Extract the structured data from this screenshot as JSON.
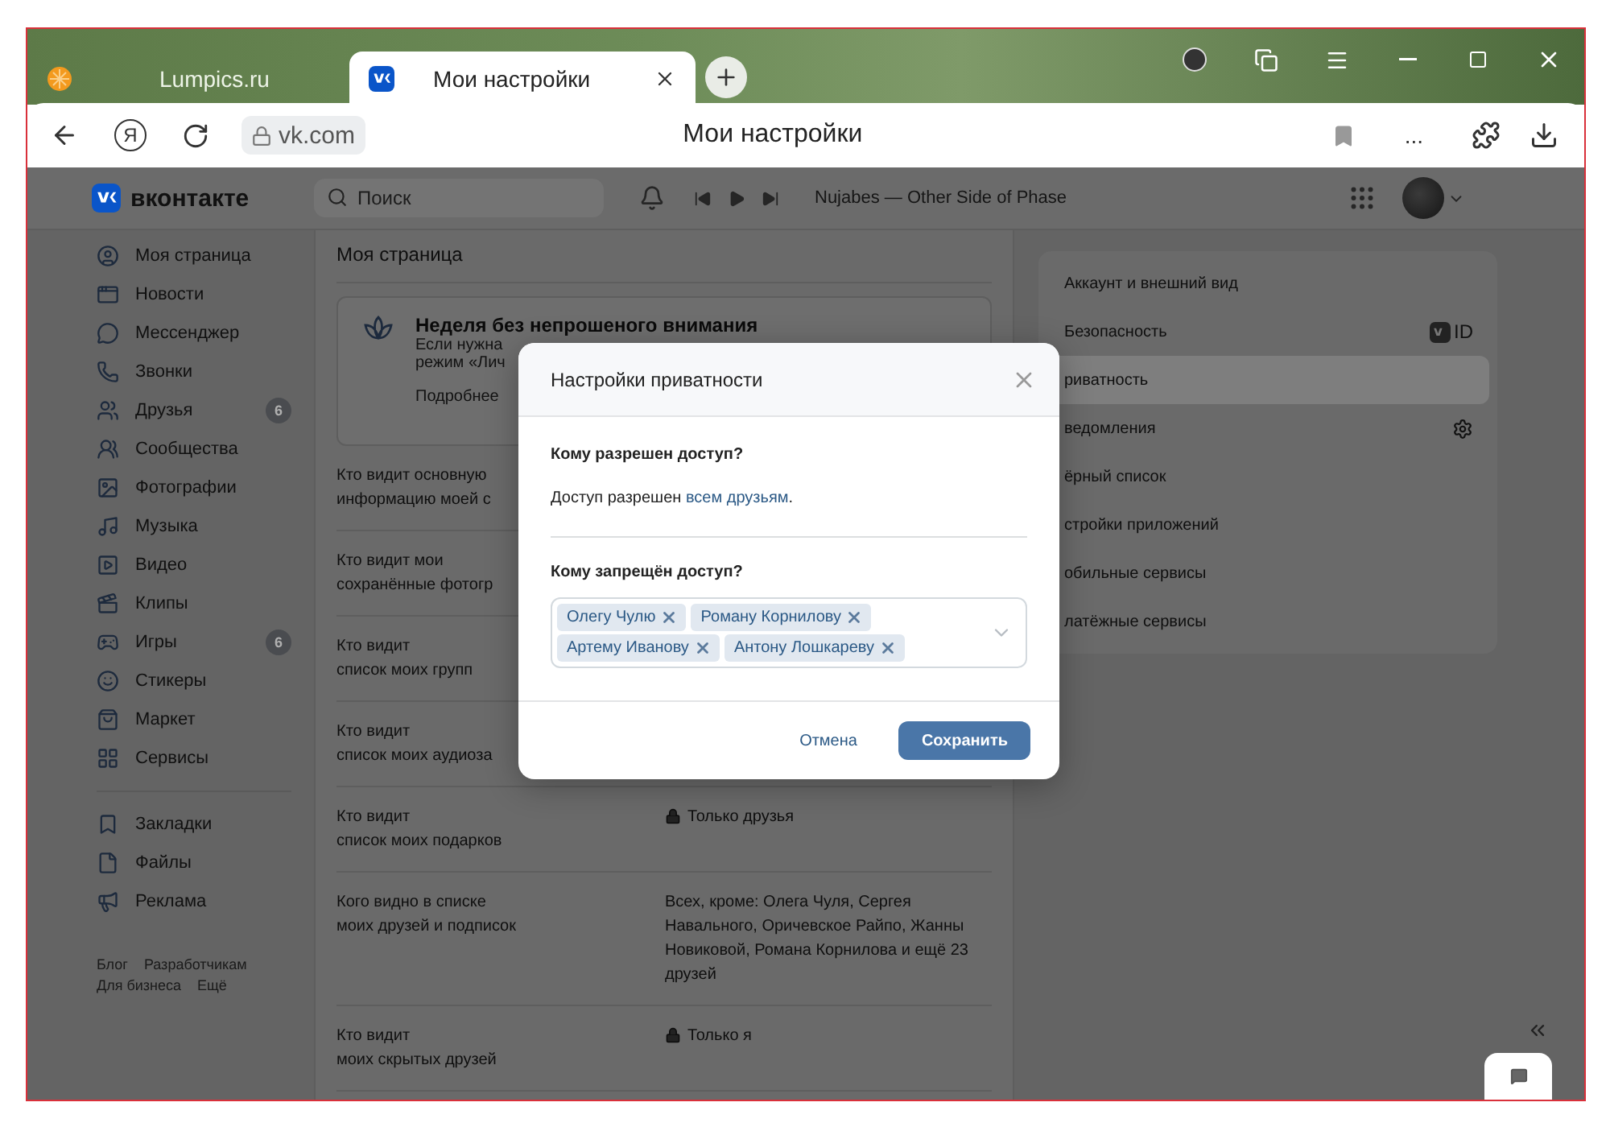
{
  "browser": {
    "tabs": [
      {
        "label": "Lumpics.ru",
        "selected": false
      },
      {
        "label": "Мои настройки",
        "selected": true
      }
    ],
    "yandex": "Я",
    "address": "vk.com",
    "page_title": "Мои настройки",
    "more": "..."
  },
  "header": {
    "logo": "вконтакте",
    "search_placeholder": "Поиск",
    "track": "Nujabes — Other Side of Phase"
  },
  "sidebar": {
    "items": [
      {
        "label": "Моя страница"
      },
      {
        "label": "Новости"
      },
      {
        "label": "Мессенджер"
      },
      {
        "label": "Звонки"
      },
      {
        "label": "Друзья",
        "badge": "6"
      },
      {
        "label": "Сообщества"
      },
      {
        "label": "Фотографии"
      },
      {
        "label": "Музыка"
      },
      {
        "label": "Видео"
      },
      {
        "label": "Клипы"
      },
      {
        "label": "Игры",
        "badge": "6"
      },
      {
        "label": "Стикеры"
      },
      {
        "label": "Маркет"
      },
      {
        "label": "Сервисы"
      }
    ],
    "extra_items": [
      {
        "label": "Закладки"
      },
      {
        "label": "Файлы"
      },
      {
        "label": "Реклама"
      }
    ],
    "footer_links": [
      "Блог",
      "Разработчикам",
      "Для бизнеса",
      "Ещё"
    ]
  },
  "content": {
    "title": "Моя страница",
    "promo": {
      "title": "Неделя без непрошеного внимания",
      "lines": [
        "Если нужна",
        "режим «Лич"
      ],
      "link": "Подробнее"
    },
    "rows": [
      {
        "label": "Кто видит основную\nинформацию моей с"
      },
      {
        "label": "Кто видит мои\nсохранённые фотогр"
      },
      {
        "label": "Кто видит\nсписок моих групп"
      },
      {
        "label": "Кто видит\nсписок моих аудиоза"
      },
      {
        "label": "Кто видит\nсписок моих подарков",
        "value": "Только друзья",
        "locked": true
      },
      {
        "label": "Кого видно в списке\nмоих друзей и подписок",
        "value": "Всех, кроме: Олега Чуля, Сергея Навального, Оричевское Райпо, Жанны Новиковой, Романа Корнилова и ещё 23 друзей",
        "locked": false
      },
      {
        "label": "Кто видит\nмоих скрытых друзей",
        "value": "Только я",
        "locked": true
      }
    ]
  },
  "settings_menu": {
    "items": [
      {
        "label": "Аккаунт и внешний вид",
        "kind": "plain",
        "selected": false
      },
      {
        "label": "Безопасность",
        "kind": "vkid",
        "badge": "ID",
        "selected": false
      },
      {
        "label": "риватность",
        "kind": "plain",
        "selected": true
      },
      {
        "label": "ведомления",
        "kind": "settings",
        "selected": false
      },
      {
        "label": "ёрный список",
        "kind": "plain",
        "selected": false
      },
      {
        "label": "стройки приложений",
        "kind": "plain",
        "selected": false
      },
      {
        "label": "обильные сервисы",
        "kind": "plain",
        "selected": false
      },
      {
        "label": "латёжные сервисы",
        "kind": "plain",
        "selected": false
      }
    ]
  },
  "dialog": {
    "title": "Настройки приватности",
    "allowed_question": "Кому разрешен доступ?",
    "allowed_text": "Доступ разрешен",
    "allowed_link": "всем друзьям",
    "allowed_suffix": ".",
    "denied_question": "Кому запрещён доступ?",
    "denied": [
      "Олегу Чулю",
      "Роману Корнилову",
      "Артему Иванову",
      "Антону Лошкареву"
    ],
    "cancel": "Отмена",
    "save": "Сохранить"
  }
}
